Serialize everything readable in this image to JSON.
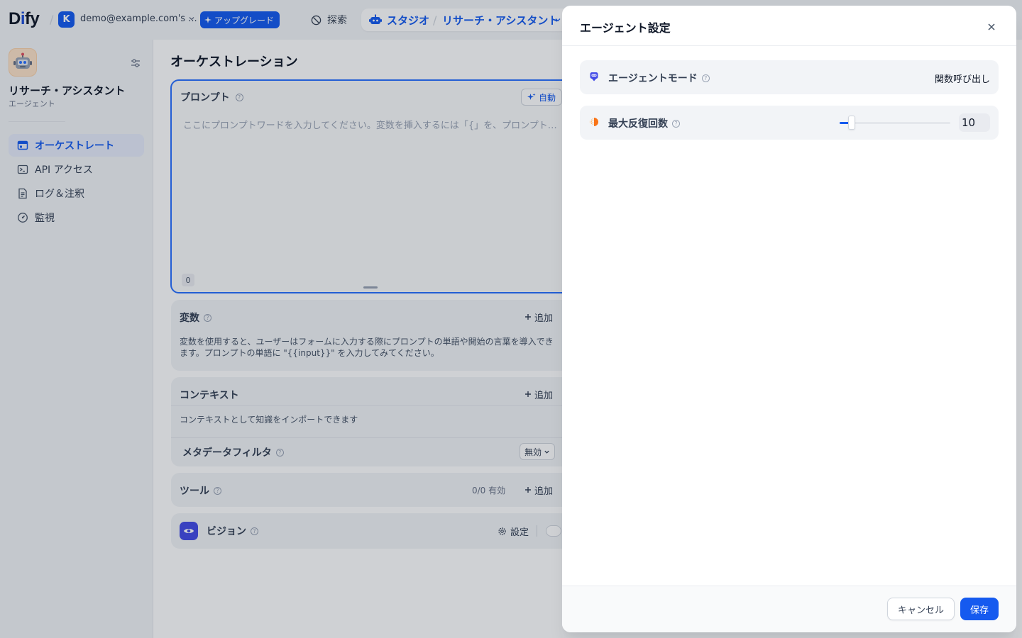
{
  "header": {
    "logo": {
      "pre": "D",
      "mid": "i",
      "post": "fy"
    },
    "workspace": {
      "initial": "K",
      "name": "demo@example.com's ..."
    },
    "upgrade_label": "アップグレード",
    "explore_label": "探索",
    "studio_label": "スタジオ",
    "app_breadcrumb": "リサーチ・アシスタント",
    "accent_color": "#155aef"
  },
  "sidebar": {
    "app_name": "リサーチ・アシスタント",
    "app_type": "エージェント",
    "app_icon": "robot-emoji",
    "items": [
      {
        "label": "オーケストレート",
        "icon": "orchestrate-icon",
        "active": true
      },
      {
        "label": "API アクセス",
        "icon": "terminal-icon",
        "active": false
      },
      {
        "label": "ログ＆注釈",
        "icon": "log-icon",
        "active": false
      },
      {
        "label": "監視",
        "icon": "gauge-icon",
        "active": false
      }
    ]
  },
  "main": {
    "title": "オーケストレーション",
    "prompt": {
      "label": "プロンプト",
      "auto_label": "自動",
      "placeholder": "ここにプロンプトワードを入力してください。変数を挿入するには「{」を、プロンプト…",
      "char_count": "0"
    },
    "variables": {
      "title": "変数",
      "add_label": "追加",
      "description": "変数を使用すると、ユーザーはフォームに入力する際にプロンプトの単語や開始の言葉を導入できます。プロンプトの単語に \"{{input}}\" を入力してみてください。"
    },
    "context": {
      "title": "コンテキスト",
      "add_label": "追加",
      "description": "コンテキストとして知識をインポートできます",
      "metadata_filter_label": "メタデータフィルタ",
      "metadata_filter_value": "無効"
    },
    "tools": {
      "title": "ツール",
      "count_label": "0/0 有効",
      "add_label": "追加"
    },
    "vision": {
      "title": "ビジョン",
      "settings_label": "設定",
      "enabled": false
    }
  },
  "drawer": {
    "title": "エージェント設定",
    "agent_mode": {
      "label": "エージェントモード",
      "value": "関数呼び出し"
    },
    "max_iterations": {
      "label": "最大反復回数",
      "value": "10",
      "slider_fraction": 0.11
    },
    "cancel_label": "キャンセル",
    "save_label": "保存"
  }
}
